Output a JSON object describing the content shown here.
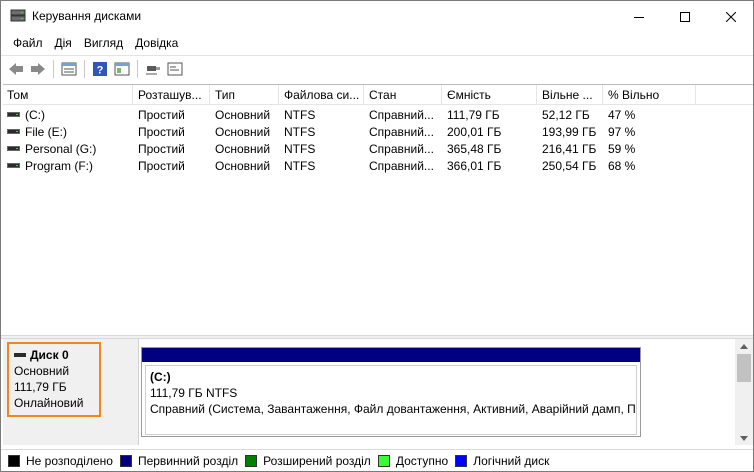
{
  "window": {
    "title": "Керування дисками"
  },
  "menu": [
    "Файл",
    "Дія",
    "Вигляд",
    "Довідка"
  ],
  "toolbar": [
    "back-icon",
    "forward-icon",
    "properties-icon",
    "help-icon",
    "view-icon",
    "connect-icon",
    "console-icon"
  ],
  "volumes": {
    "headers": [
      "Том",
      "Розташув...",
      "Тип",
      "Файлова си...",
      "Стан",
      "Ємність",
      "Вільне ...",
      "% Вільно"
    ],
    "rows": [
      [
        "(C:)",
        "Простий",
        "Основний",
        "NTFS",
        "Справний...",
        "111,79 ГБ",
        "52,12 ГБ",
        "47 %"
      ],
      [
        "File (E:)",
        "Простий",
        "Основний",
        "NTFS",
        "Справний...",
        "200,01 ГБ",
        "193,99 ГБ",
        "97 %"
      ],
      [
        "Personal (G:)",
        "Простий",
        "Основний",
        "NTFS",
        "Справний...",
        "365,48 ГБ",
        "216,41 ГБ",
        "59 %"
      ],
      [
        "Program (F:)",
        "Простий",
        "Основний",
        "NTFS",
        "Справний...",
        "366,01 ГБ",
        "250,54 ГБ",
        "68 %"
      ]
    ]
  },
  "disk": {
    "title": "Диск 0",
    "type": "Основний",
    "size": "111,79 ГБ",
    "status": "Онлайновий",
    "highlight_color": "#f0871e"
  },
  "partition": {
    "name": "(C:)",
    "size_fs": "111,79 ГБ NTFS",
    "status": "Справний (Система, Завантаження, Файл довантаження, Активний, Аварійний дамп, Пе",
    "bar_color": "#000080"
  },
  "legend": [
    {
      "label": "Не розподілено",
      "color": "#000000"
    },
    {
      "label": "Первинний розділ",
      "color": "#000080"
    },
    {
      "label": "Розширений розділ",
      "color": "#008000"
    },
    {
      "label": "Доступно",
      "color": "#33ff33"
    },
    {
      "label": "Логічний диск",
      "color": "#0000ff"
    }
  ]
}
